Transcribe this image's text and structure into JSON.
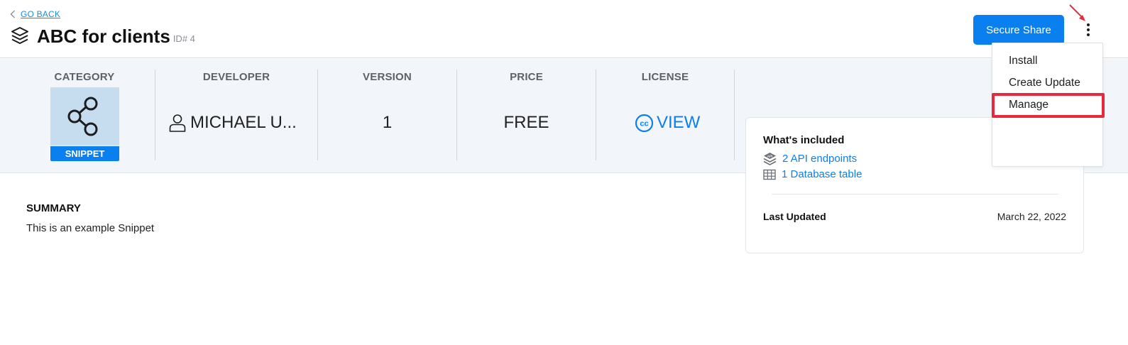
{
  "header": {
    "go_back": "GO BACK",
    "title": "ABC for clients",
    "id_tag": "ID# 4",
    "share_button": "Secure Share"
  },
  "info": {
    "category": {
      "label": "CATEGORY",
      "badge": "SNIPPET",
      "icon": "share-nodes-icon"
    },
    "developer": {
      "label": "DEVELOPER",
      "value": "MICHAEL U...",
      "icon": "user-icon"
    },
    "version": {
      "label": "VERSION",
      "value": "1"
    },
    "price": {
      "label": "PRICE",
      "value": "FREE"
    },
    "license": {
      "label": "LICENSE",
      "value": "VIEW",
      "icon": "creative-commons-icon"
    }
  },
  "summary": {
    "heading": "SUMMARY",
    "text": "This is an example Snippet"
  },
  "included": {
    "heading": "What's included",
    "items": [
      {
        "label": "2 API endpoints",
        "icon": "api-layers-icon"
      },
      {
        "label": "1 Database table",
        "icon": "table-icon"
      }
    ],
    "last_updated_label": "Last Updated",
    "last_updated_value": "March 22, 2022"
  },
  "menu": {
    "items": [
      "Install",
      "Create Update",
      "Manage"
    ],
    "highlighted": "Manage"
  },
  "colors": {
    "accent": "#0a7ff0",
    "band_bg": "#f2f6fa",
    "highlight": "#e8283d"
  }
}
